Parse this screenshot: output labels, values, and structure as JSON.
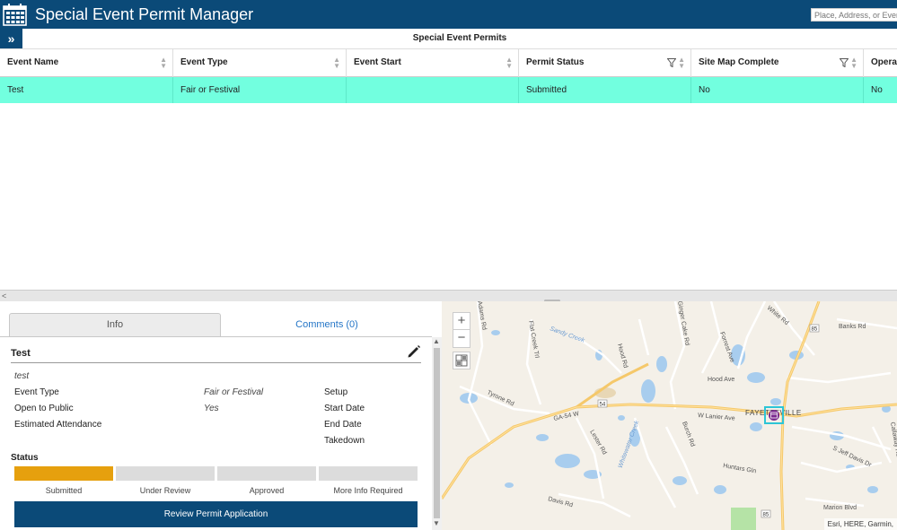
{
  "app": {
    "title": "Special Event Permit Manager",
    "search_placeholder": "Place, Address, or Event",
    "brand_color": "#0b4a78",
    "icon": "calendar-icon"
  },
  "grid": {
    "title": "Special Event Permits",
    "columns": [
      "Event Name",
      "Event Type",
      "Event Start",
      "Permit Status",
      "Site Map Complete",
      "Operat"
    ],
    "rows": [
      {
        "event_name": "Test",
        "event_type": "Fair or Festival",
        "event_start": "",
        "permit_status": "Submitted",
        "site_map_complete": "No",
        "operat": "No"
      }
    ],
    "highlight_color": "#72ffdf"
  },
  "tabs": {
    "info": "Info",
    "comments": "Comments (0)"
  },
  "record": {
    "title": "Test",
    "description": "test",
    "fields_left": [
      {
        "label": "Event Type",
        "value": "Fair or Festival"
      },
      {
        "label": "Open to Public",
        "value": "Yes"
      },
      {
        "label": "Estimated Attendance",
        "value": ""
      }
    ],
    "fields_right": [
      {
        "label": "Setup"
      },
      {
        "label": "Start Date"
      },
      {
        "label": "End Date"
      },
      {
        "label": "Takedown"
      }
    ],
    "status_title": "Status",
    "status_steps": [
      {
        "label": "Submitted",
        "active": true
      },
      {
        "label": "Under Review",
        "active": false
      },
      {
        "label": "Approved",
        "active": false
      },
      {
        "label": "More Info Required",
        "active": false
      }
    ],
    "status_active_color": "#e6a00e",
    "review_button": "Review Permit Application"
  },
  "map": {
    "zoom_in": "+",
    "zoom_out": "−",
    "attribution": "Esri, HERE, Garmin,",
    "labels": {
      "banks_rd": "Banks Rd",
      "forrest_ave": "Forrest Ave",
      "white_rd": "White Rd",
      "hood_ave": "Hood Ave",
      "hood_rd": "Hood Rd",
      "flat_creek_trl": "Flat Creek Trl",
      "sandy_creek": "Sandy Creek",
      "tyrone_rd": "Tyrone Rd",
      "ga54": "GA-54 W",
      "w_lanier": "W Lanier Ave",
      "fayetteville": "FAYETTEVILLE",
      "lester_rd": "Lester Rd",
      "whitewater_creek": "Whitewater Creek",
      "burch_rd": "Burch Rd",
      "huntars_gln": "Huntars Gln",
      "s_jeff_davis": "S Jeff Davis Dr",
      "davis_rd": "Davis Rd",
      "marion_blvd": "Marion Blvd",
      "ginger_cake": "Ginger Cake Rd",
      "callaway": "Callaway Rd",
      "adams_rd": "Adams Rd",
      "route_85": "85",
      "route_54": "54"
    }
  }
}
